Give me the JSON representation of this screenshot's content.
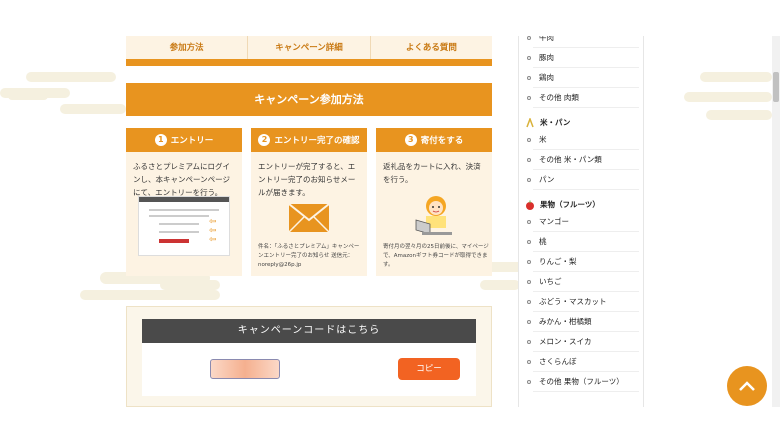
{
  "tabs": [
    {
      "label": "参加方法"
    },
    {
      "label": "キャンペーン詳細"
    },
    {
      "label": "よくある質問"
    }
  ],
  "banner_title": "キャンペーン参加方法",
  "steps": [
    {
      "num": "1",
      "title": "エントリー",
      "body": "ふるさとプレミアムにログインし、本キャンペーンページにて、エントリーを行う。",
      "foot": ""
    },
    {
      "num": "2",
      "title": "エントリー完了の確認",
      "body": "エントリーが完了すると、エントリー完了のお知らせメールが届きます。",
      "foot": "件名：「ふるさとプレミアム」キャンペーンエントリー完了のお知らせ 送信元：noreply@26p.jp"
    },
    {
      "num": "3",
      "title": "寄付をする",
      "body": "返礼品をカートに入れ、決済を行う。",
      "foot": "寄付月の翌々月の25日前後に、マイページで、Amazonギフト券コードが取得できます。"
    }
  ],
  "code_section": {
    "title": "キャンペーンコードはこちら",
    "copy_label": "コピー"
  },
  "sidebar": {
    "items_top": [
      {
        "label": "牛肉"
      },
      {
        "label": "豚肉"
      },
      {
        "label": "鶏肉"
      },
      {
        "label": "その他 肉類"
      }
    ],
    "cat_rice": "米・パン",
    "items_rice": [
      {
        "label": "米"
      },
      {
        "label": "その他 米・パン類"
      },
      {
        "label": "パン"
      }
    ],
    "cat_fruit": "果物（フルーツ）",
    "items_fruit": [
      {
        "label": "マンゴー"
      },
      {
        "label": "桃"
      },
      {
        "label": "りんご・梨"
      },
      {
        "label": "いちご"
      },
      {
        "label": "ぶどう・マスカット"
      },
      {
        "label": "みかん・柑橘類"
      },
      {
        "label": "メロン・スイカ"
      },
      {
        "label": "さくらんぼ"
      },
      {
        "label": "その他 果物（フルーツ）"
      }
    ]
  },
  "colors": {
    "accent": "#e8941f",
    "copy_button": "#f26322",
    "panel": "#fdf3e3"
  },
  "icons": [
    "chevron-down-icon",
    "envelope-icon",
    "person-laptop-icon",
    "rice-icon",
    "apple-icon",
    "arrow-up-icon"
  ]
}
